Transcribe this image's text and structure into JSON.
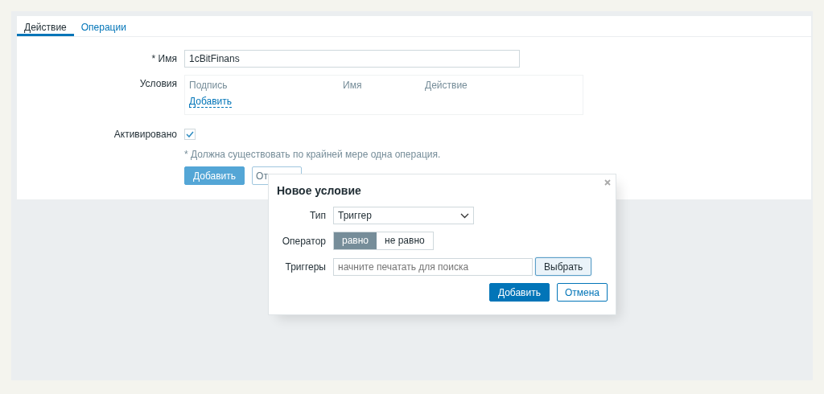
{
  "tabs": [
    {
      "label": "Действие",
      "selected": true
    },
    {
      "label": "Операции",
      "selected": false
    }
  ],
  "form": {
    "name_label": "* Имя",
    "name_value": "1cBitFinans",
    "conditions_label": "Условия",
    "conditions_columns": [
      "Подпись",
      "Имя",
      "Действие"
    ],
    "conditions_add_link": "Добавить",
    "enabled_label": "Активировано",
    "enabled_checked": true,
    "note": "* Должна существовать по крайней мере одна операция.",
    "buttons": [
      {
        "label": "Добавить",
        "kind": "primary"
      },
      {
        "label": "От",
        "kind": "secondary"
      }
    ]
  },
  "dialog": {
    "title": "Новое условие",
    "type_label": "Тип",
    "type_value": "Триггер",
    "operator_label": "Оператор",
    "operator_options": [
      {
        "label": "равно",
        "selected": true
      },
      {
        "label": "не равно",
        "selected": false
      }
    ],
    "triggers_label": "Триггеры",
    "triggers_placeholder": "начните печатать для поиска",
    "select_button": "Выбрать",
    "buttons": [
      {
        "label": "Добавить",
        "kind": "primary"
      },
      {
        "label": "Отмена",
        "kind": "secondary"
      }
    ]
  }
}
